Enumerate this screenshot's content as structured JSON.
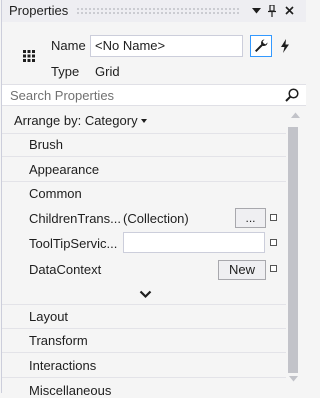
{
  "panel": {
    "title": "Properties"
  },
  "titlebar_buttons": {
    "dropdown": "▾",
    "pin": "📌",
    "close": "✕"
  },
  "header": {
    "name_label": "Name",
    "name_value": "<No Name>",
    "type_label": "Type",
    "type_value": "Grid",
    "properties_tab_icon": "wrench-icon",
    "events_tab_icon": "lightning-icon"
  },
  "search": {
    "placeholder": "Search Properties"
  },
  "arrange": {
    "label": "Arrange by: Category"
  },
  "categories": [
    {
      "label": "Brush",
      "expanded": false
    },
    {
      "label": "Appearance",
      "expanded": false
    },
    {
      "label": "Common",
      "expanded": true
    },
    {
      "label": "Layout",
      "expanded": false
    },
    {
      "label": "Transform",
      "expanded": false
    },
    {
      "label": "Interactions",
      "expanded": false
    },
    {
      "label": "Miscellaneous",
      "expanded": false
    }
  ],
  "common_properties": [
    {
      "name": "ChildrenTrans...",
      "value": "(Collection)",
      "button": "..."
    },
    {
      "name": "ToolTipServic...",
      "value": ""
    },
    {
      "name": "DataContext",
      "value": "",
      "button": "New"
    }
  ],
  "colors": {
    "accent": "#3399ff",
    "panel_bg": "#f5f5f5",
    "scroll_thumb": "#c2c3c9"
  }
}
